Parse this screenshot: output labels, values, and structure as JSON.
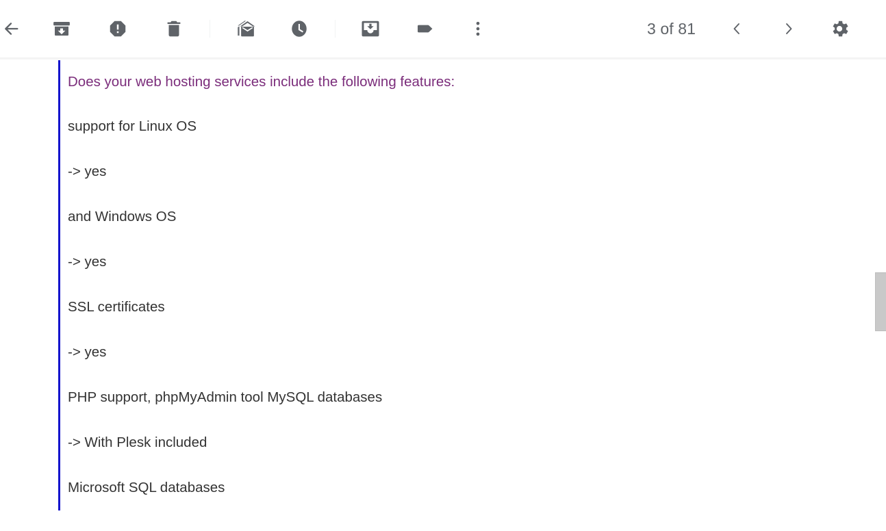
{
  "toolbar": {
    "back_label": "Back to Inbox",
    "actions": [
      {
        "name": "archive",
        "label": "Archive",
        "icon": "archive-icon"
      },
      {
        "name": "report-spam",
        "label": "Report spam",
        "icon": "report-spam-icon"
      },
      {
        "name": "delete",
        "label": "Delete",
        "icon": "trash-icon"
      },
      {
        "name": "mark-unread",
        "label": "Mark as unread",
        "icon": "mark-unread-icon"
      },
      {
        "name": "snooze",
        "label": "Snooze",
        "icon": "clock-icon"
      },
      {
        "name": "move-to",
        "label": "Move to",
        "icon": "move-to-inbox-icon"
      },
      {
        "name": "labels",
        "label": "Labels",
        "icon": "label-tag-icon"
      },
      {
        "name": "more",
        "label": "More",
        "icon": "more-vertical-icon"
      }
    ],
    "pager": {
      "count_text": "3 of 81",
      "current": 3,
      "total": 81,
      "newer_label": "Newer",
      "older_label": "Older"
    },
    "settings_label": "Settings",
    "icon_color": "#5f6368",
    "divider_color": "#f1f3f4"
  },
  "message": {
    "quote_bar_color": "#1414cc",
    "quoted_text_color": "#7b2d7b",
    "body_text_color": "#333333",
    "lines": [
      {
        "text": "Does your web hosting services include the following features:",
        "quoted": true
      },
      {
        "text": "support for Linux OS",
        "quoted": false
      },
      {
        "text": "-> yes",
        "quoted": false
      },
      {
        "text": "and Windows OS",
        "quoted": false
      },
      {
        "text": "-> yes",
        "quoted": false
      },
      {
        "text": "SSL certificates",
        "quoted": false
      },
      {
        "text": "-> yes",
        "quoted": false
      },
      {
        "text": "PHP support, phpMyAdmin tool MySQL databases",
        "quoted": false
      },
      {
        "text": "-> With Plesk included",
        "quoted": false
      },
      {
        "text": "Microsoft SQL databases",
        "quoted": false
      }
    ]
  },
  "scrollbar": {
    "label": "Vertical scrollbar",
    "thumb_color": "#c9c9c9"
  }
}
